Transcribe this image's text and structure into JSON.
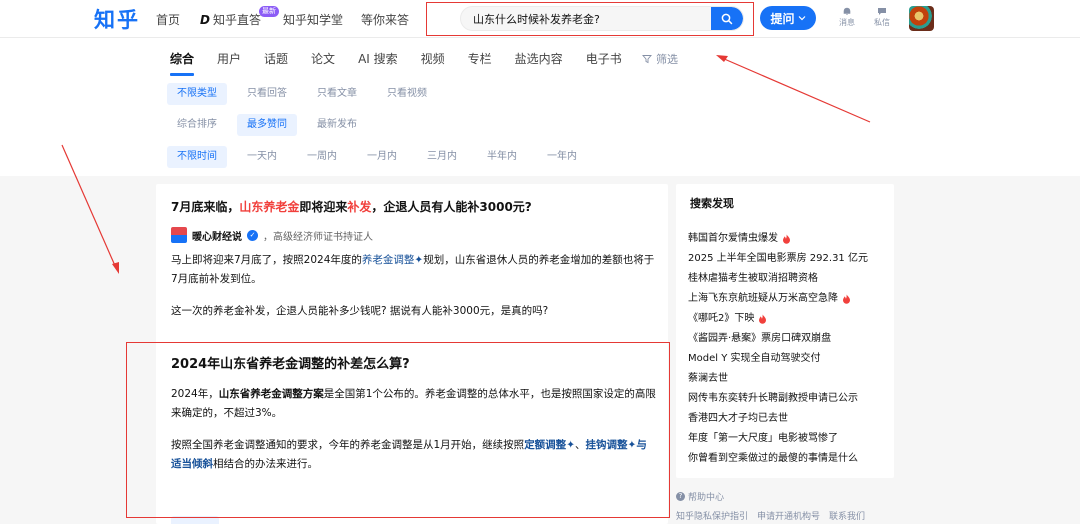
{
  "header": {
    "logo": "知乎",
    "nav": [
      "首页",
      "知乎直答",
      "知乎知学堂",
      "等你来答"
    ],
    "zhida_badge": "最新",
    "search": {
      "value": "山东什么时候补发养老金?"
    },
    "ask_label": "提问",
    "messages_label": "消息",
    "dm_label": "私信"
  },
  "tabs": [
    "综合",
    "用户",
    "话题",
    "论文",
    "AI 搜索",
    "视频",
    "专栏",
    "盐选内容",
    "电子书"
  ],
  "filter_label": "筛选",
  "chips": {
    "type": [
      "不限类型",
      "只看回答",
      "只看文章",
      "只看视频"
    ],
    "sort": [
      "综合排序",
      "最多赞同",
      "最新发布"
    ],
    "time": [
      "不限时间",
      "一天内",
      "一周内",
      "一月内",
      "三月内",
      "半年内",
      "一年内"
    ]
  },
  "post": {
    "title_pre": "7月底来临，",
    "title_hl1": "山东养老金",
    "title_mid": "即将迎来",
    "title_hl2": "补发",
    "title_post": "，企退人员有人能补3000元?",
    "author": "暖心财经说",
    "author_desc": "，高级经济师证书持证人",
    "p1_a": "马上即将迎来7月底了，按照2024年度的",
    "p1_link": "养老金调整",
    "p1_b": "规划，山东省退休人员的养老金增加的差额也将于7月底前补发到位。",
    "p2": "这一次的养老金补发，企退人员能补多少钱呢? 据说有人能补3000元，是真的吗?",
    "section_title": "2024年山东省养老金调整的补差怎么算?",
    "s1_a": "2024年，",
    "s1_bold": "山东省养老金调整方案",
    "s1_b": "是全国第1个公布的。养老金调整的总体水平，也是按照国家设定的高限来确定的，不超过3%。",
    "s2_a": "按照全国养老金调整通知的要求，今年的养老金调整是从1月开始，继续按照",
    "s2_link1": "定额调整",
    "s2_sep": "、",
    "s2_link2": "挂钩调整",
    "s2_link3": "与适当倾斜",
    "s2_b": "相结合的办法来进行。"
  },
  "sidebar": {
    "title": "搜索发现",
    "items": [
      {
        "text": "韩国首尔爱情虫爆发",
        "hot": true
      },
      {
        "text": "2025 上半年全国电影票房 292.31 亿元",
        "hot": false
      },
      {
        "text": "桂林虐猫考生被取消招聘资格",
        "hot": false
      },
      {
        "text": "上海飞东京航班疑从万米高空急降",
        "hot": true
      },
      {
        "text": "《哪吒2》下映",
        "hot": true
      },
      {
        "text": "《酱园弄·悬案》票房口碑双崩盘",
        "hot": false
      },
      {
        "text": "Model Y 实现全自动驾驶交付",
        "hot": false
      },
      {
        "text": "蔡澜去世",
        "hot": false
      },
      {
        "text": "网传韦东奕转升长聘副教授申请已公示",
        "hot": false
      },
      {
        "text": "香港四大才子均已去世",
        "hot": false
      },
      {
        "text": "年度「第一大尺度」电影被骂惨了",
        "hot": false
      },
      {
        "text": "你曾看到空乘做过的最傻的事情是什么",
        "hot": false
      }
    ],
    "help": "帮助中心",
    "links": [
      "知乎隐私保护指引",
      "申请开通机构号",
      "联系我们"
    ]
  },
  "colors": {
    "brand": "#1772f6",
    "highlight": "#f1403c",
    "annotation": "#e53935"
  }
}
